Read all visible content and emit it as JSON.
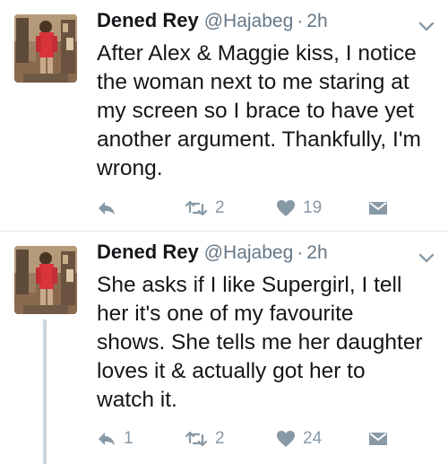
{
  "tweets": [
    {
      "name": "Dened Rey",
      "handle": "@Hajabeg",
      "separator": "·",
      "time": "2h",
      "lines": [
        "After Alex & Maggie kiss, I notice",
        "the woman next to me staring at",
        "my screen so I brace to have yet",
        "another argument. Thankfully, I'm",
        "wrong."
      ],
      "reply_count": "",
      "retweet_count": "2",
      "like_count": "19"
    },
    {
      "name": "Dened Rey",
      "handle": "@Hajabeg",
      "separator": "·",
      "time": "2h",
      "lines": [
        "She asks if I like Supergirl, I tell",
        "her it's one of my favourite",
        "shows. She tells me her daughter",
        "loves it & actually got her to",
        "watch it."
      ],
      "reply_count": "1",
      "retweet_count": "2",
      "like_count": "24"
    }
  ],
  "colors": {
    "text": "#14171a",
    "meta": "#657786",
    "icon": "#8899a6",
    "divider": "#e1e8ed",
    "thread_line": "#ccd6dd"
  },
  "icons": [
    "reply-icon",
    "retweet-icon",
    "like-icon",
    "direct-message-icon",
    "caret-down-icon"
  ]
}
